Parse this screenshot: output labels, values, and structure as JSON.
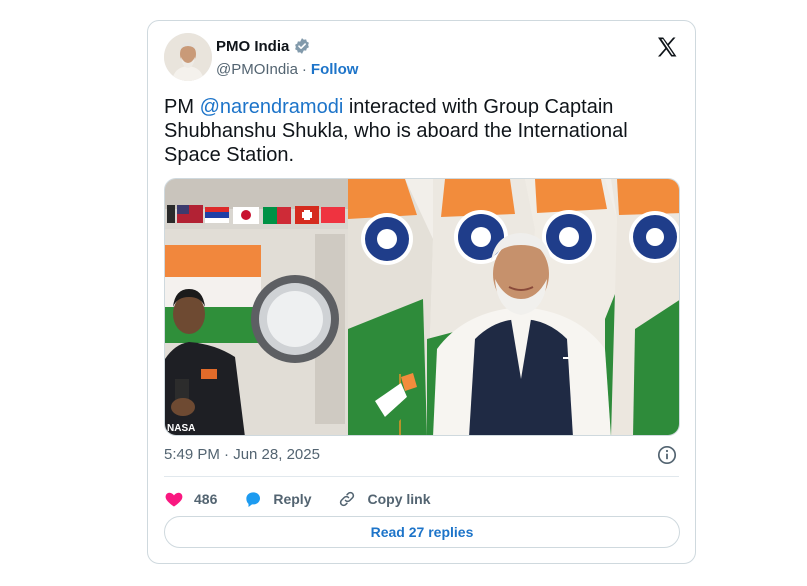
{
  "author": {
    "name": "PMO India",
    "handle": "@PMOIndia",
    "separator": "·",
    "follow_label": "Follow"
  },
  "tweet": {
    "prefix": "PM ",
    "mention": "@narendramodi",
    "suffix": " interacted with Group Captain Shubhanshu Shukla, who is aboard the International Space Station."
  },
  "media": {
    "watermark": "NASA"
  },
  "meta": {
    "timestamp": "5:49 PM · Jun 28, 2025"
  },
  "actions": {
    "like_count": "486",
    "reply_label": "Reply",
    "copy_label": "Copy link"
  },
  "replies_button": "Read 27 replies",
  "colors": {
    "accent": "#1d74c9",
    "like": "#f91880",
    "reply": "#1d9bf0",
    "border": "#cfd9de",
    "muted": "#536471"
  }
}
